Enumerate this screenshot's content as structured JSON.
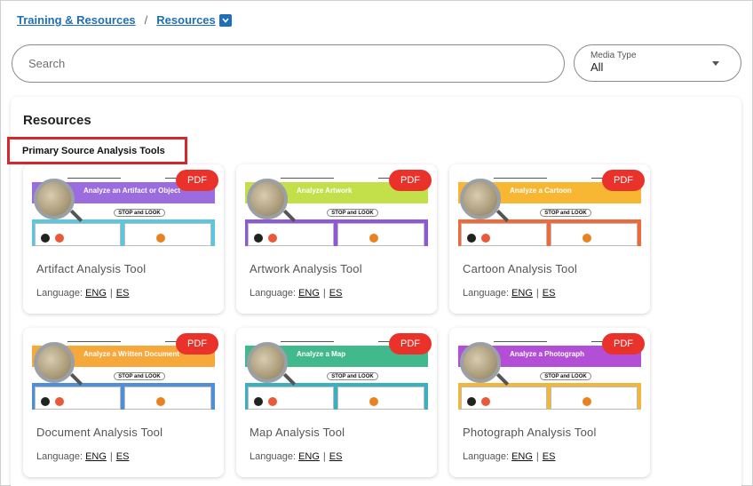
{
  "breadcrumb": {
    "items": [
      "Training & Resources",
      "Resources"
    ],
    "separator": "/"
  },
  "search": {
    "placeholder": "Search",
    "value": ""
  },
  "media_type": {
    "label": "Media Type",
    "value": "All"
  },
  "panel": {
    "title": "Resources",
    "section_title": "Primary Source Analysis Tools"
  },
  "cards": [
    {
      "title": "Artifact Analysis Tool",
      "thumb_heading": "Analyze an Artifact or Object",
      "band_color": "#9b6be0",
      "lower_color": "#5bc7df",
      "badge": "PDF",
      "language_label": "Language:",
      "links": [
        "ENG",
        "ES"
      ]
    },
    {
      "title": "Artwork Analysis Tool",
      "thumb_heading": "Analyze Artwork",
      "band_color": "#c3e04a",
      "lower_color": "#8d5ad4",
      "badge": "PDF",
      "language_label": "Language:",
      "links": [
        "ENG",
        "ES"
      ]
    },
    {
      "title": "Cartoon Analysis Tool",
      "thumb_heading": "Analyze a Cartoon",
      "band_color": "#f7b733",
      "lower_color": "#ee6a3a",
      "badge": "PDF",
      "language_label": "Language:",
      "links": [
        "ENG",
        "ES"
      ]
    },
    {
      "title": "Document Analysis Tool",
      "thumb_heading": "Analyze a Written Document",
      "band_color": "#f7a83a",
      "lower_color": "#4d8fd8",
      "badge": "PDF",
      "language_label": "Language:",
      "links": [
        "ENG",
        "ES"
      ]
    },
    {
      "title": "Map Analysis Tool",
      "thumb_heading": "Analyze a Map",
      "band_color": "#42b98c",
      "lower_color": "#3bb0c0",
      "badge": "PDF",
      "language_label": "Language:",
      "links": [
        "ENG",
        "ES"
      ]
    },
    {
      "title": "Photograph Analysis Tool",
      "thumb_heading": "Analyze a Photograph",
      "band_color": "#b24fd6",
      "lower_color": "#f2b63a",
      "badge": "PDF",
      "language_label": "Language:",
      "links": [
        "ENG",
        "ES"
      ]
    }
  ],
  "thumb_common": {
    "stop_label": "STOP and LOOK"
  }
}
